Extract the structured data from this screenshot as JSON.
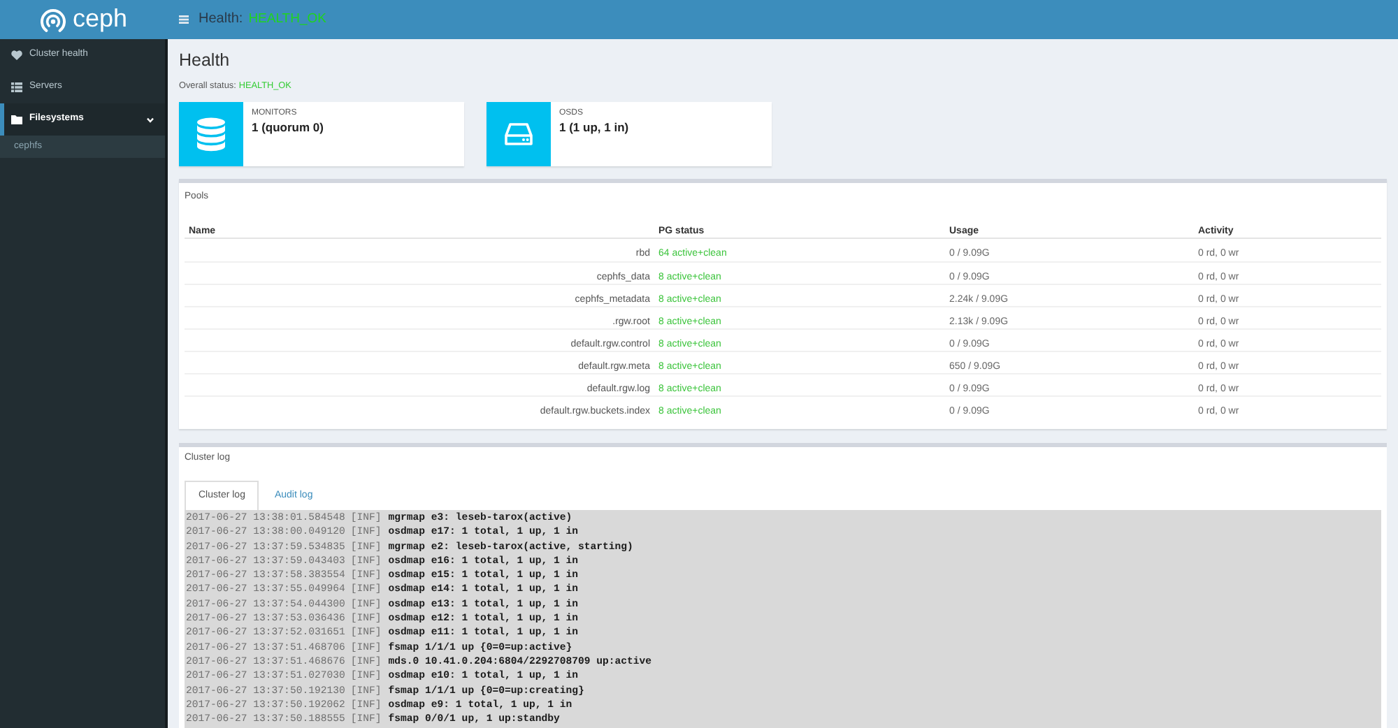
{
  "top_bar": {
    "logo": "ceph",
    "title": "Health:",
    "status": "HEALTH_OK"
  },
  "sidebar": {
    "items": [
      {
        "label": "Cluster health",
        "selected": false
      },
      {
        "label": "Servers",
        "selected": false
      },
      {
        "label": "Filesystems",
        "selected": true,
        "expanded": true,
        "children": [
          {
            "label": "cephfs",
            "selected": false
          }
        ]
      }
    ]
  },
  "page": {
    "title": "Health",
    "status_label": "Overall status:",
    "status": "HEALTH_OK"
  },
  "info_boxes": [
    {
      "label": "MONITORS",
      "value": "1 (quorum 0)"
    },
    {
      "label": "OSDS",
      "value": "1 (1 up, 1 in)"
    }
  ],
  "pools": {
    "title": "Pools",
    "columns": [
      "Name",
      "PG status",
      "Usage",
      "Activity"
    ],
    "rows": [
      {
        "name": "rbd",
        "pg_status": "64 active+clean",
        "usage": "0 / 9.09G",
        "activity": "0 rd, 0 wr"
      },
      {
        "name": "cephfs_data",
        "pg_status": "8 active+clean",
        "usage": "0 / 9.09G",
        "activity": "0 rd, 0 wr"
      },
      {
        "name": "cephfs_metadata",
        "pg_status": "8 active+clean",
        "usage": "2.24k / 9.09G",
        "activity": "0 rd, 0 wr"
      },
      {
        "name": ".rgw.root",
        "pg_status": "8 active+clean",
        "usage": "2.13k / 9.09G",
        "activity": "0 rd, 0 wr"
      },
      {
        "name": "default.rgw.control",
        "pg_status": "8 active+clean",
        "usage": "0 / 9.09G",
        "activity": "0 rd, 0 wr"
      },
      {
        "name": "default.rgw.meta",
        "pg_status": "8 active+clean",
        "usage": "650 / 9.09G",
        "activity": "0 rd, 0 wr"
      },
      {
        "name": "default.rgw.log",
        "pg_status": "8 active+clean",
        "usage": "0 / 9.09G",
        "activity": "0 rd, 0 wr"
      },
      {
        "name": "default.rgw.buckets.index",
        "pg_status": "8 active+clean",
        "usage": "0 / 9.09G",
        "activity": "0 rd, 0 wr"
      }
    ]
  },
  "cluster_log": {
    "title": "Cluster log",
    "tabs": [
      {
        "label": "Cluster log",
        "selected": true
      },
      {
        "label": "Audit log",
        "selected": false
      }
    ],
    "entries": [
      {
        "time": "2017-06-27 13:38:01.584548",
        "level": "[INF]",
        "message": "mgrmap e3: leseb-tarox(active)"
      },
      {
        "time": "2017-06-27 13:38:00.049120",
        "level": "[INF]",
        "message": "osdmap e17: 1 total, 1 up, 1 in"
      },
      {
        "time": "2017-06-27 13:37:59.534835",
        "level": "[INF]",
        "message": "mgrmap e2: leseb-tarox(active, starting)"
      },
      {
        "time": "2017-06-27 13:37:59.043403",
        "level": "[INF]",
        "message": "osdmap e16: 1 total, 1 up, 1 in"
      },
      {
        "time": "2017-06-27 13:37:58.383554",
        "level": "[INF]",
        "message": "osdmap e15: 1 total, 1 up, 1 in"
      },
      {
        "time": "2017-06-27 13:37:55.049964",
        "level": "[INF]",
        "message": "osdmap e14: 1 total, 1 up, 1 in"
      },
      {
        "time": "2017-06-27 13:37:54.044300",
        "level": "[INF]",
        "message": "osdmap e13: 1 total, 1 up, 1 in"
      },
      {
        "time": "2017-06-27 13:37:53.036436",
        "level": "[INF]",
        "message": "osdmap e12: 1 total, 1 up, 1 in"
      },
      {
        "time": "2017-06-27 13:37:52.031651",
        "level": "[INF]",
        "message": "osdmap e11: 1 total, 1 up, 1 in"
      },
      {
        "time": "2017-06-27 13:37:51.468706",
        "level": "[INF]",
        "message": "fsmap 1/1/1 up {0=0=up:active}"
      },
      {
        "time": "2017-06-27 13:37:51.468676",
        "level": "[INF]",
        "message": "mds.0 10.41.0.204:6804/2292708709 up:active"
      },
      {
        "time": "2017-06-27 13:37:51.027030",
        "level": "[INF]",
        "message": "osdmap e10: 1 total, 1 up, 1 in"
      },
      {
        "time": "2017-06-27 13:37:50.192130",
        "level": "[INF]",
        "message": "fsmap 1/1/1 up {0=0=up:creating}"
      },
      {
        "time": "2017-06-27 13:37:50.192062",
        "level": "[INF]",
        "message": "osdmap e9: 1 total, 1 up, 1 in"
      },
      {
        "time": "2017-06-27 13:37:50.188555",
        "level": "[INF]",
        "message": "fsmap 0/0/1 up, 1 up:standby"
      }
    ]
  }
}
